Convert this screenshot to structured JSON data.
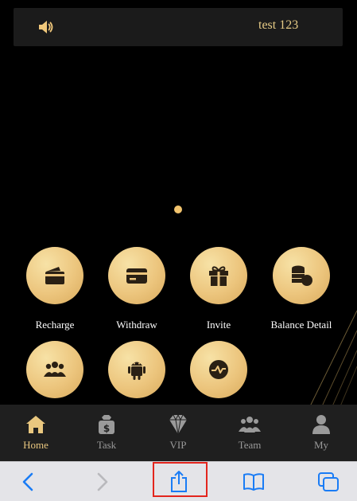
{
  "notice": {
    "icon": "speaker-icon",
    "text": "test 123"
  },
  "banner": {
    "indicator_count": 1
  },
  "features": [
    {
      "label": "Recharge",
      "icon": "wallet-icon"
    },
    {
      "label": "Withdraw",
      "icon": "card-icon"
    },
    {
      "label": "Invite",
      "icon": "gift-icon"
    },
    {
      "label": "Balance Detail",
      "icon": "coins-icon"
    },
    {
      "label": "",
      "icon": "group-icon"
    },
    {
      "label": "",
      "icon": "android-icon"
    },
    {
      "label": "",
      "icon": "chart-wave-icon"
    }
  ],
  "tabs": [
    {
      "label": "Home",
      "icon": "home-icon",
      "active": true
    },
    {
      "label": "Task",
      "icon": "money-bag-icon",
      "active": false
    },
    {
      "label": "VIP",
      "icon": "diamond-icon",
      "active": false
    },
    {
      "label": "Team",
      "icon": "team-icon",
      "active": false
    },
    {
      "label": "My",
      "icon": "user-icon",
      "active": false
    }
  ],
  "browser_toolbar": {
    "items": [
      "back-icon",
      "forward-icon",
      "share-icon",
      "bookmarks-icon",
      "tabs-icon"
    ]
  },
  "colors": {
    "gold": "#ecc57d",
    "gold_text": "#e6cb86",
    "active_tab": "#e9c77f",
    "inactive_tab": "#9a9a9a",
    "ios_blue": "#1a7cf5",
    "highlight_red": "#e3251d"
  }
}
